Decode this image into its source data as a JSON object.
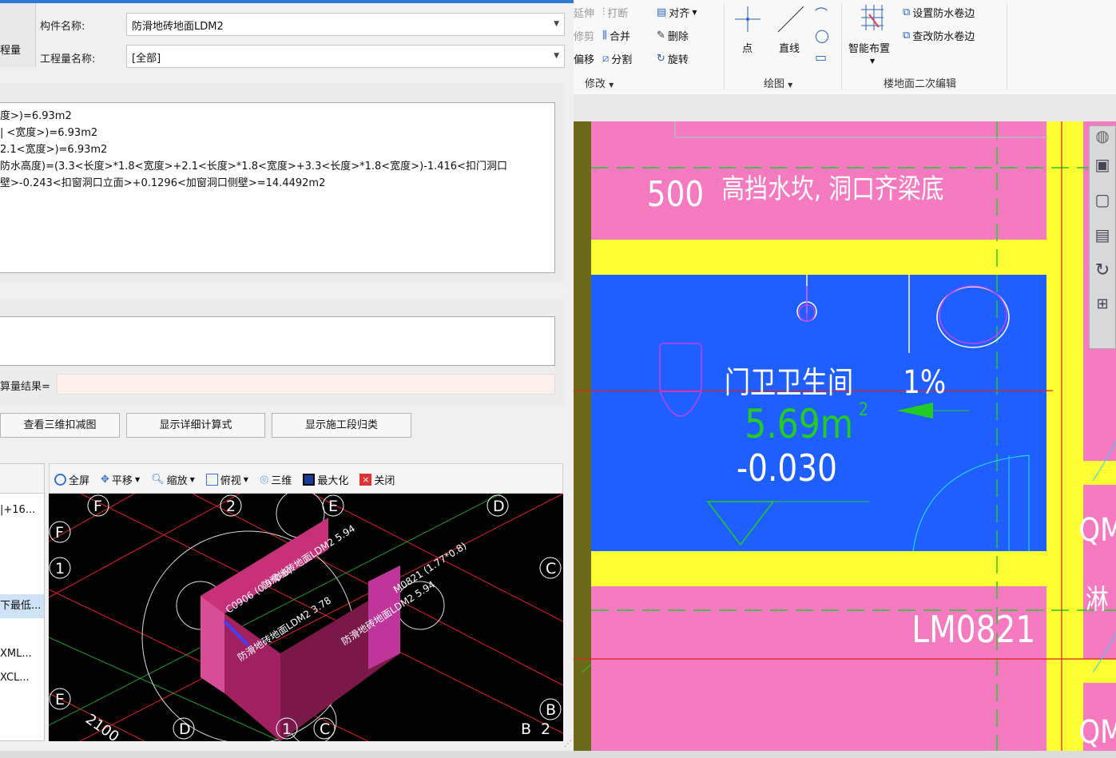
{
  "header": {
    "component_label": "构件名称:",
    "component_value": "防滑地砖地面LDM2",
    "quantity_label": "工程量名称:",
    "quantity_value": "[全部]",
    "left_tab": "程量"
  },
  "formulas": [
    "度>)=6.93m2",
    "| <宽度>)=6.93m2",
    "2.1<宽度>)=6.93m2",
    "防水高度)=(3.3<长度>*1.8<宽度>+2.1<长度>*1.8<宽度>+3.3<长度>*1.8<宽度>)-1.416<扣门洞口",
    "壁>-0.243<扣窗洞口立面>+0.1296<加窗洞口侧壁>=14.4492m2"
  ],
  "calc_result_label": "算量结果=",
  "buttons": {
    "view3d": "查看三维扣减图",
    "detail": "显示详细计算式",
    "stage": "显示施工段归类"
  },
  "list_items": [
    "|+16...",
    "下最低...",
    "XML...",
    "XCL..."
  ],
  "viewer_toolbar": {
    "fullscreen": "全屏",
    "pan": "平移",
    "zoom": "缩放",
    "topview": "俯视",
    "threed": "三维",
    "maximize": "最大化",
    "close": "关闭"
  },
  "viewer_labels": {
    "axis": [
      "F",
      "2",
      "E",
      "D",
      "F",
      "1",
      "C",
      "E",
      "B",
      "D",
      "1",
      "C",
      "B",
      "2"
    ],
    "dim": "2100",
    "t1": "C0906 (0.9*0.6)",
    "t2": "防滑地砖地面LDM2 5.94",
    "t3": "防滑地砖地面LDM2 3.78",
    "t4": "M0821 (1.77*0.8)",
    "t5": "防滑地砖地面LDM2 5.94"
  },
  "ribbon": {
    "edit_items": [
      "延伸",
      "打断",
      "对齐",
      "修剪",
      "合并",
      "删除",
      "偏移",
      "分割",
      "旋转"
    ],
    "modify_group": "修改",
    "draw_items": [
      "点",
      "直线"
    ],
    "draw_group": "绘图",
    "smart_layout": "智能布置",
    "set_waterproof": "设置防水卷边",
    "modify_waterproof": "查改防水卷边",
    "floor_group": "楼地面二次编辑"
  },
  "cad": {
    "t500": "500",
    "t_note": "高挡水坎, 洞口齐梁底",
    "room_name": "门卫卫生间",
    "area": "5.69m",
    "area_sup": "2",
    "level": "-0.030",
    "slope": "1%",
    "door": "LM0821",
    "edge1": "QM",
    "edge2": "淋",
    "edge3": "QM"
  },
  "colors": {
    "pink": "#f57ac0",
    "yellow": "#ffff33",
    "blue": "#1f5fff",
    "accent": "#2c78d4"
  }
}
